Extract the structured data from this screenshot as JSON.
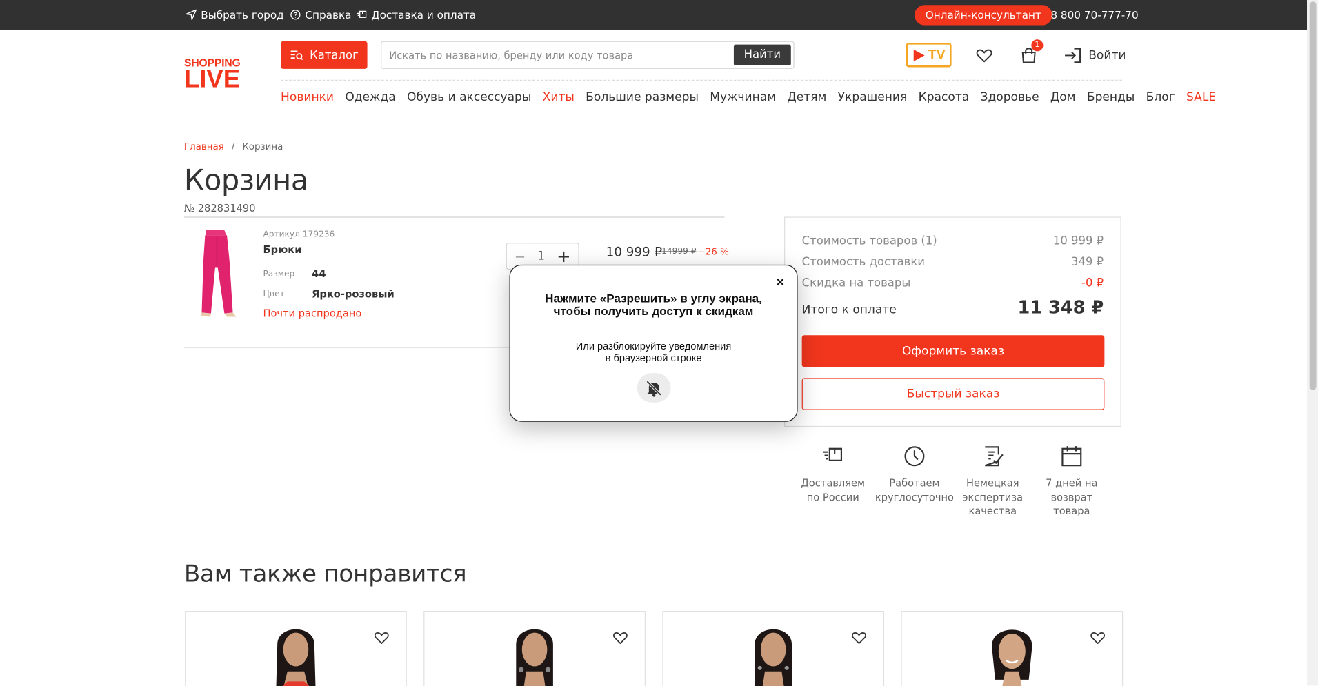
{
  "topbar": {
    "city": "Выбрать город",
    "help": "Справка",
    "delivery": "Доставка и оплата",
    "consultant": "Онлайн-консультант",
    "phone": "8 800 70-777-70"
  },
  "header": {
    "logo_top": "SHOPPING",
    "logo_bottom": "LIVE",
    "catalog": "Каталог",
    "search_placeholder": "Искать по названию, бренду или коду товара",
    "search_button": "Найти",
    "tv_label": "TV",
    "cart_count": "1",
    "login": "Войти"
  },
  "nav": [
    "Новинки",
    "Одежда",
    "Обувь и аксессуары",
    "Хиты",
    "Большие размеры",
    "Мужчинам",
    "Детям",
    "Украшения",
    "Красота",
    "Здоровье",
    "Дом",
    "Бренды",
    "Блог",
    "SALE"
  ],
  "nav_red": [
    "Новинки",
    "Хиты",
    "SALE"
  ],
  "breadcrumbs": {
    "home": "Главная",
    "sep": "/",
    "current": "Корзина"
  },
  "page": {
    "title": "Корзина",
    "order_number": "№ 282831490"
  },
  "product": {
    "article": "Артикул 179236",
    "name": "Брюки",
    "size_label": "Размер",
    "size_value": "44",
    "color_label": "Цвет",
    "color_value": "Ярко-розовый",
    "stock": "Почти распродано",
    "qty": "1",
    "qty_minus": "−",
    "qty_plus": "+",
    "price": "10 999 ₽",
    "old_price": "14999 ₽",
    "discount": "−26 %"
  },
  "summary": {
    "goods_label": "Стоимость товаров (1)",
    "goods_value": "10 999 ₽",
    "delivery_label": "Стоимость доставки",
    "delivery_value": "349 ₽",
    "discount_label": "Скидка на товары",
    "discount_value": "-0 ₽",
    "total_label": "Итого к оплате",
    "total_value": "11 348 ₽",
    "checkout": "Оформить заказ",
    "quick_order": "Быстрый заказ"
  },
  "features": [
    {
      "icon": "delivery-icon",
      "text1": "Доставляем",
      "text2": "по России",
      "text3": ""
    },
    {
      "icon": "clock-icon",
      "text1": "Работаем",
      "text2": "круглосуточно",
      "text3": ""
    },
    {
      "icon": "checklist-icon",
      "text1": "Немецкая",
      "text2": "экспертиза",
      "text3": "качества"
    },
    {
      "icon": "calendar-icon",
      "text1": "7 дней на",
      "text2": "возврат",
      "text3": "товара"
    }
  ],
  "popup": {
    "close": "×",
    "line1": "Нажмите «Разрешить» в углу экрана,",
    "line2": "чтобы получить доступ к скидкам",
    "line3": "Или разблокируйте уведомления",
    "line4": "в браузерной строке",
    "icon": "bell-off-icon"
  },
  "recommendations": {
    "title": "Вам также понравится"
  },
  "colors": {
    "accent": "#f1361d",
    "topbar": "#313131",
    "tv": "#f5a623"
  }
}
